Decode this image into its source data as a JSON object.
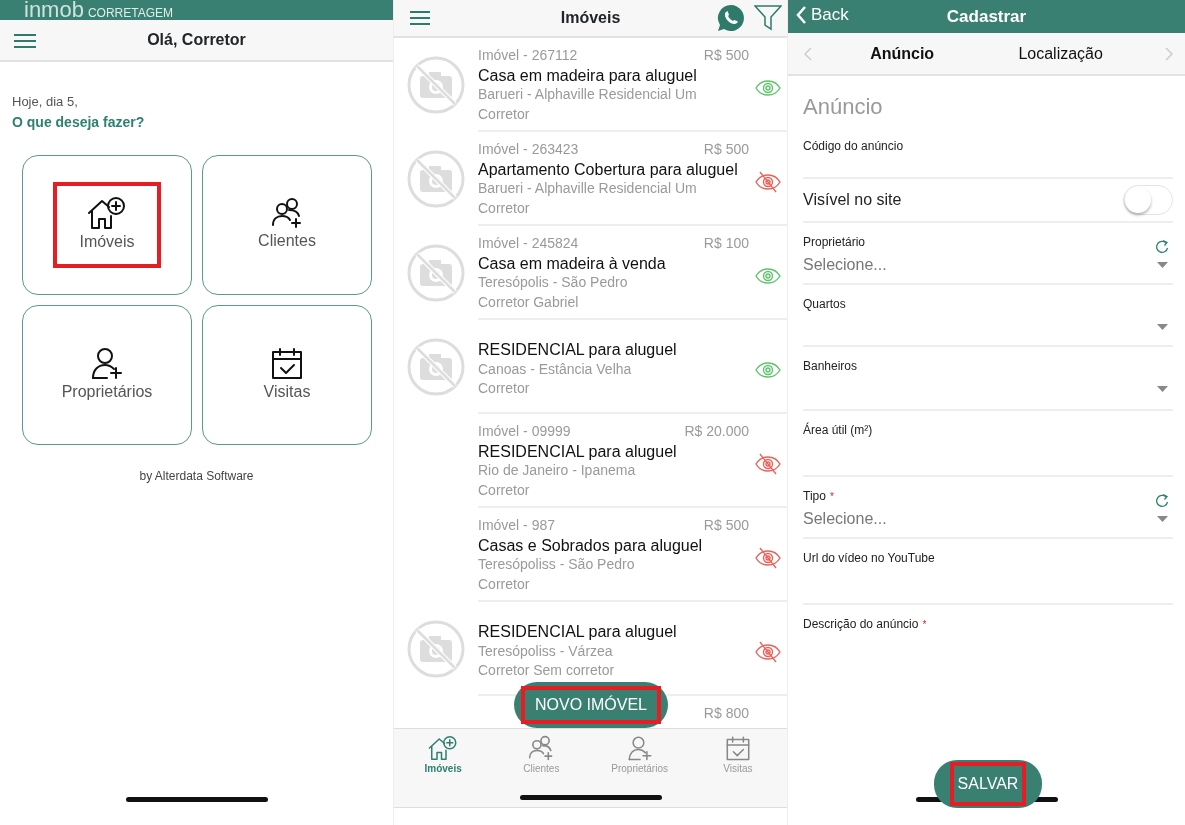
{
  "home": {
    "brand": {
      "logo": "inmob",
      "tagline": "CORRETAGEM"
    },
    "header": {
      "title": "Olá, Corretor"
    },
    "greeting": "Hoje, dia 5,",
    "question": "O que deseja fazer?",
    "tiles": [
      {
        "label": "Imóveis",
        "highlighted": true
      },
      {
        "label": "Clientes",
        "highlighted": false
      },
      {
        "label": "Proprietários",
        "highlighted": false
      },
      {
        "label": "Visitas",
        "highlighted": false
      }
    ],
    "footer": "by Alterdata Software"
  },
  "listing": {
    "header": {
      "title": "Imóveis"
    },
    "items": [
      {
        "code": "Imóvel - 267112",
        "price": "R$ 500",
        "title": "Casa em madeira para aluguel",
        "location": "Barueri - Alphaville Residencial Um",
        "agent": "Corretor",
        "thumbnail": true,
        "visible": true
      },
      {
        "code": "Imóvel - 263423",
        "price": "R$ 500",
        "title": "Apartamento Cobertura para aluguel",
        "location": "Barueri - Alphaville Residencial Um",
        "agent": "Corretor",
        "thumbnail": true,
        "visible": false
      },
      {
        "code": "Imóvel - 245824",
        "price": "R$ 100",
        "title": "Casa em madeira à venda",
        "location": "Teresópolis - São Pedro",
        "agent": "Corretor Gabriel",
        "thumbnail": true,
        "visible": true
      },
      {
        "title": "RESIDENCIAL para aluguel",
        "location": "Canoas - Estância Velha",
        "agent": "Corretor",
        "thumbnail": true,
        "visible": true
      },
      {
        "code": "Imóvel - 09999",
        "price": "R$ 20.000",
        "title": "RESIDENCIAL para aluguel",
        "location": "Rio de Janeiro - Ipanema",
        "agent": "Corretor",
        "thumbnail": false,
        "visible": false
      },
      {
        "code": "Imóvel - 987",
        "price": "R$ 500",
        "title": "Casas e Sobrados para aluguel",
        "location": "Teresópoliss - São Pedro",
        "agent": "Corretor",
        "thumbnail": false,
        "visible": false
      },
      {
        "title": "RESIDENCIAL para aluguel",
        "location": "Teresópoliss - Várzea",
        "agent": "Corretor Sem corretor",
        "thumbnail": true,
        "visible": false
      },
      {
        "price": "R$ 800"
      }
    ],
    "new_button": {
      "label": "NOVO IMÓVEL",
      "highlighted": true
    },
    "tabs": [
      {
        "label": "Imóveis",
        "selected": true
      },
      {
        "label": "Clientes",
        "selected": false
      },
      {
        "label": "Proprietários",
        "selected": false
      },
      {
        "label": "Visitas",
        "selected": false
      }
    ]
  },
  "form": {
    "header": {
      "back": "Back",
      "title": "Cadastrar"
    },
    "tabs": [
      {
        "label": "Anúncio",
        "selected": true
      },
      {
        "label": "Localização",
        "selected": false
      }
    ],
    "section_title": "Anúncio",
    "fields": [
      {
        "kind": "text",
        "label": "Código do anúncio"
      },
      {
        "kind": "toggle",
        "label": "Visível no site",
        "on": false
      },
      {
        "kind": "select",
        "label": "Proprietário",
        "placeholder": "Selecione...",
        "refresh": true
      },
      {
        "kind": "select",
        "label": "Quartos",
        "refresh": false
      },
      {
        "kind": "select",
        "label": "Banheiros",
        "refresh": false
      },
      {
        "kind": "text",
        "label": "Área útil (m²)"
      },
      {
        "kind": "select",
        "label": "Tipo",
        "required_mark": "*",
        "placeholder": "Selecione...",
        "refresh": true
      },
      {
        "kind": "text",
        "label": "Url do vídeo no YouTube"
      },
      {
        "kind": "area",
        "label": "Descrição do anúncio",
        "required_mark": "*"
      }
    ],
    "save_button": {
      "label": "SALVAR",
      "highlighted": true
    }
  }
}
